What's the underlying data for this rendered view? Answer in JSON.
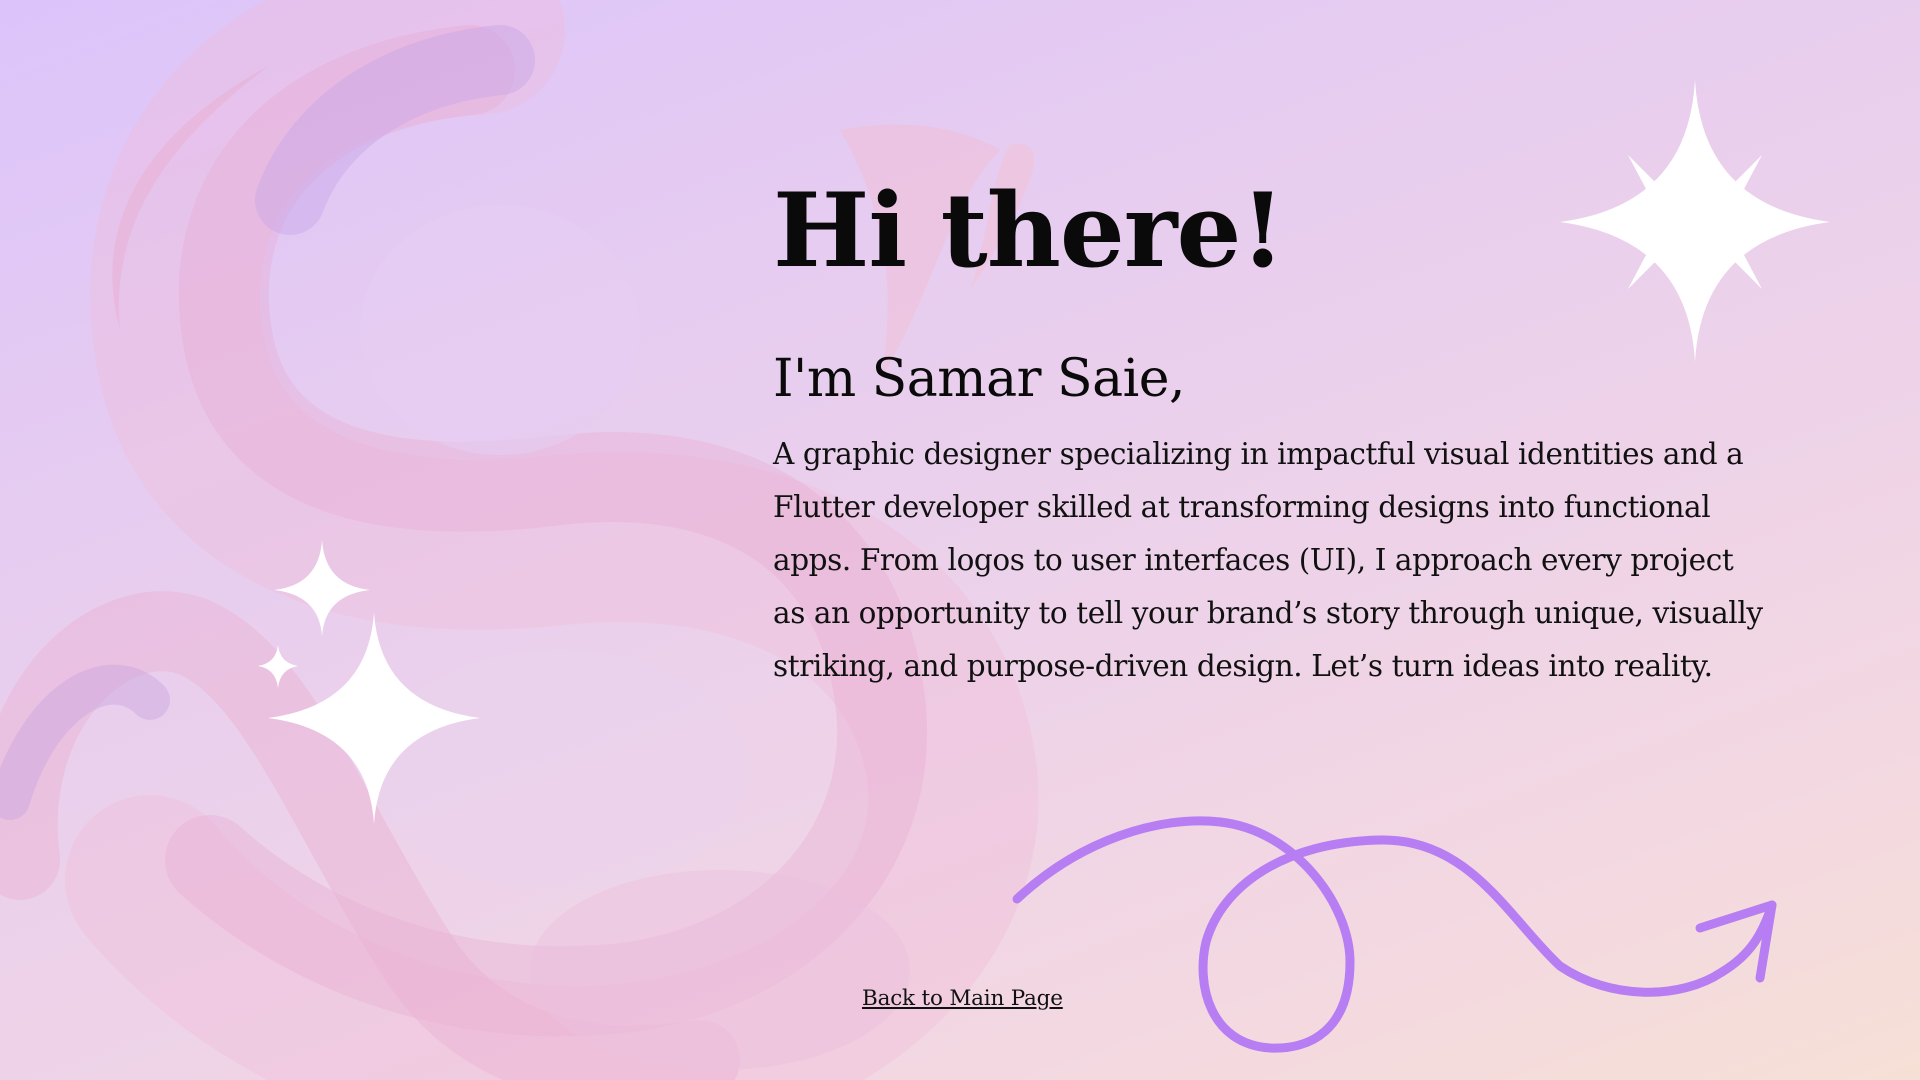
{
  "heading": {
    "title": "Hi there!",
    "subtitle": "I'm Samar Saie,"
  },
  "intro": {
    "text": "A graphic designer specializing in impactful visual identities and a Flutter developer skilled at transforming designs into functional apps. From logos to user interfaces (UI), I approach every project as an opportunity to tell your brand’s story through unique, visually striking, and purpose-driven design. Let’s turn ideas into reality."
  },
  "nav": {
    "back_label": "Back to Main Page"
  },
  "colors": {
    "accent": "#b67ef2",
    "text": "#0a0a0a",
    "sparkle": "#ffffff",
    "background_start": "#dcc4fb",
    "background_end": "#f6e0d6"
  },
  "icons": {
    "decor_letter": "swirl-s-graphic",
    "sparkle_large": "four-point-sparkle-icon",
    "sparkle_top_right": "eight-point-star-icon",
    "arrow": "loop-arrow-icon"
  }
}
